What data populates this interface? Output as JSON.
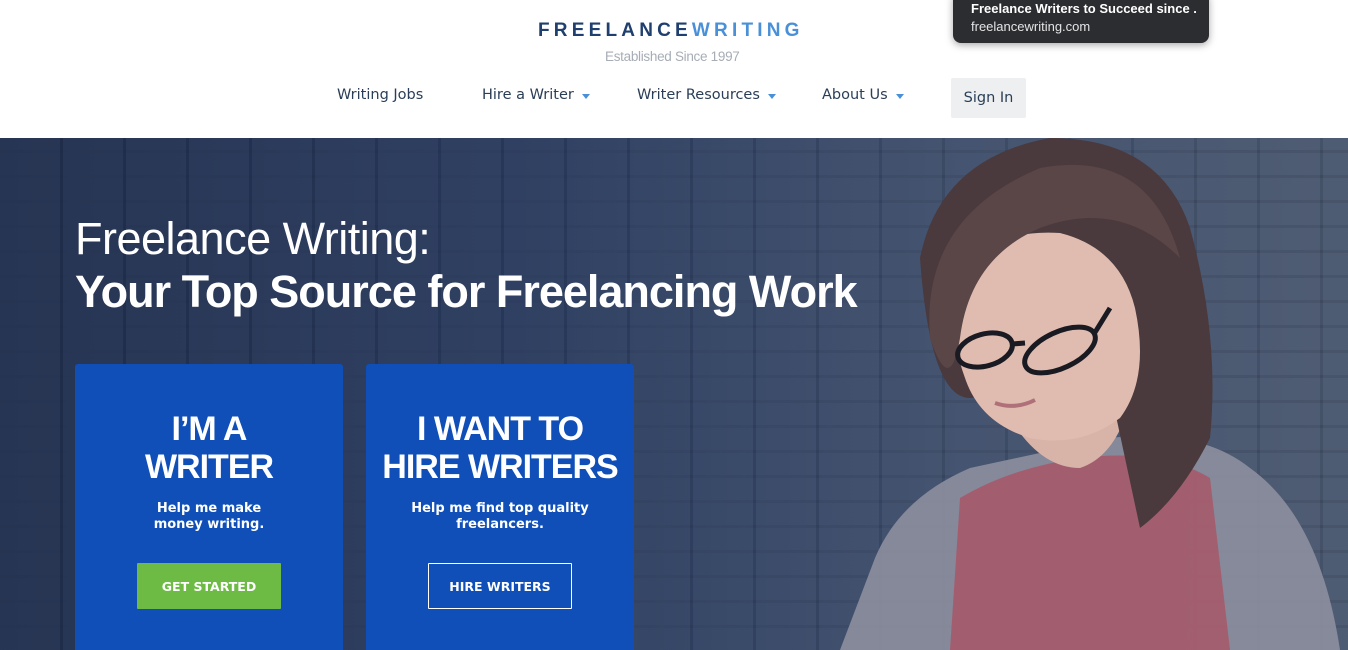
{
  "logo": {
    "part1": "FREELANCE",
    "part2": "WRITING",
    "tagline": "Established Since 1997"
  },
  "nav": {
    "items": [
      {
        "label": "Writing Jobs"
      },
      {
        "label": "Hire a Writer"
      },
      {
        "label": "Writer Resources"
      },
      {
        "label": "About Us"
      }
    ],
    "signin": "Sign In"
  },
  "tooltip": {
    "title": "Freelance Writers to Succeed since ...",
    "url": "freelancewriting.com"
  },
  "hero": {
    "line1": "Freelance Writing:",
    "line2": "Your Top Source for Freelancing Work"
  },
  "cards": [
    {
      "heading_line1": "I’M A",
      "heading_line2": "WRITER",
      "desc_line1": "Help me make",
      "desc_line2": "money writing.",
      "button": "GET STARTED"
    },
    {
      "heading_line1": "I WANT TO",
      "heading_line2": "HIRE WRITERS",
      "desc_line1": "Help me find top quality",
      "desc_line2": "freelancers.",
      "button": "HIRE WRITERS"
    }
  ],
  "colors": {
    "card_blue": "#0f4fb7",
    "accent_green": "#6dbb45",
    "logo_dark": "#1f3f6e",
    "logo_light": "#4a90d9"
  }
}
